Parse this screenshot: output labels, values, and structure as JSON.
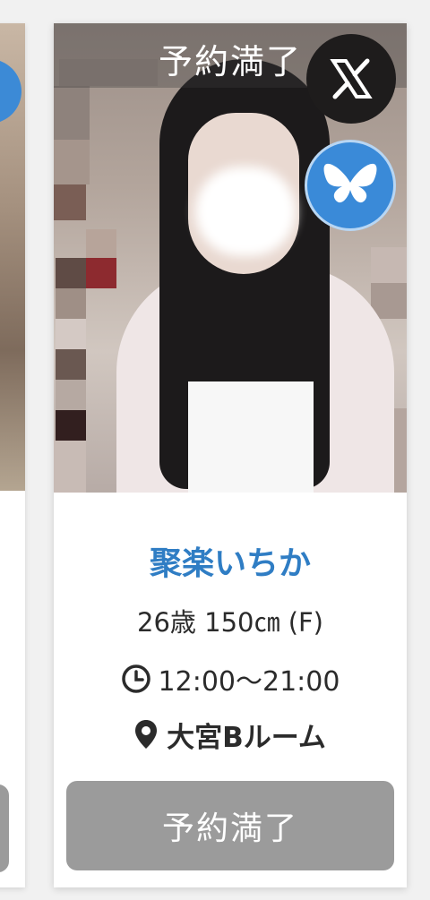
{
  "card": {
    "status_overlay": "予約満了",
    "name": "聚楽いちか",
    "profile": "26歳 150㎝ (F)",
    "hours": "12:00〜21:00",
    "area": "大宮Bルーム",
    "reserve_button": "予約満了"
  },
  "icons": {
    "x": "x-logo-icon",
    "bluesky": "bluesky-butterfly-icon",
    "clock": "clock-icon",
    "pin": "map-pin-icon"
  },
  "colors": {
    "name": "#2f7dc4",
    "button": "#9b9b9b",
    "x_badge": "#1e1c1c",
    "bluesky_badge": "#3a8ad8"
  }
}
